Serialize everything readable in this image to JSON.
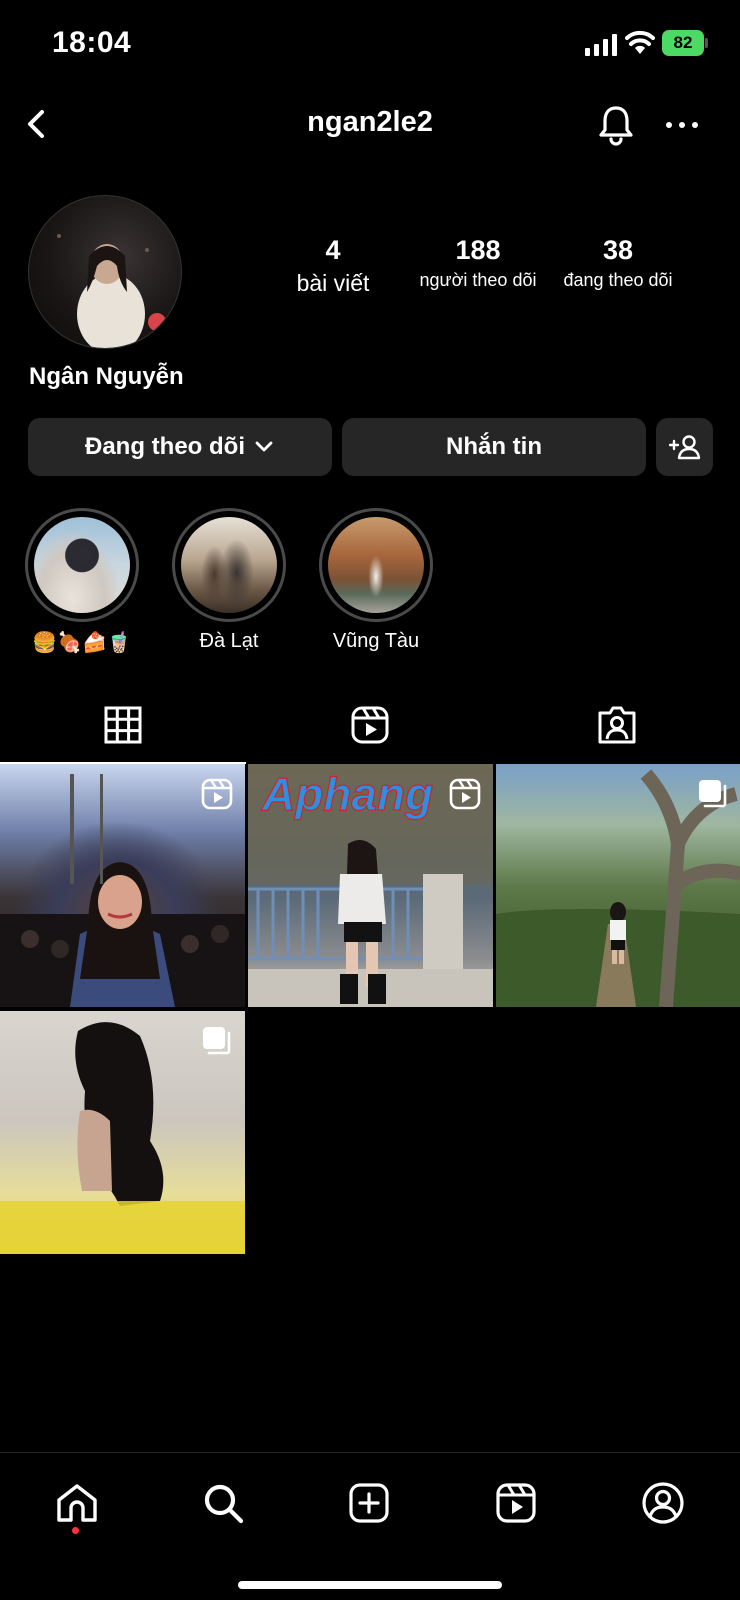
{
  "status_bar": {
    "time": "18:04",
    "battery": "82"
  },
  "header": {
    "username": "ngan2le2"
  },
  "profile": {
    "display_name": "Ngân Nguyễn",
    "stats": [
      {
        "value": "4",
        "label": "bài viết"
      },
      {
        "value": "188",
        "label": "người theo dõi"
      },
      {
        "value": "38",
        "label": "đang theo dõi"
      }
    ]
  },
  "actions": {
    "following_label": "Đang theo dõi",
    "message_label": "Nhắn tin"
  },
  "highlights": [
    {
      "label": "🍔🍖🍰🧋"
    },
    {
      "label": "Đà Lạt"
    },
    {
      "label": "Vũng Tàu"
    }
  ],
  "posts": [
    {
      "type": "reel"
    },
    {
      "type": "reel",
      "overlay_text": "Aphang"
    },
    {
      "type": "carousel"
    },
    {
      "type": "carousel"
    }
  ],
  "colors": {
    "background": "#000000",
    "button": "#262626",
    "battery": "#4cd964",
    "notification_dot": "#ff3040"
  }
}
